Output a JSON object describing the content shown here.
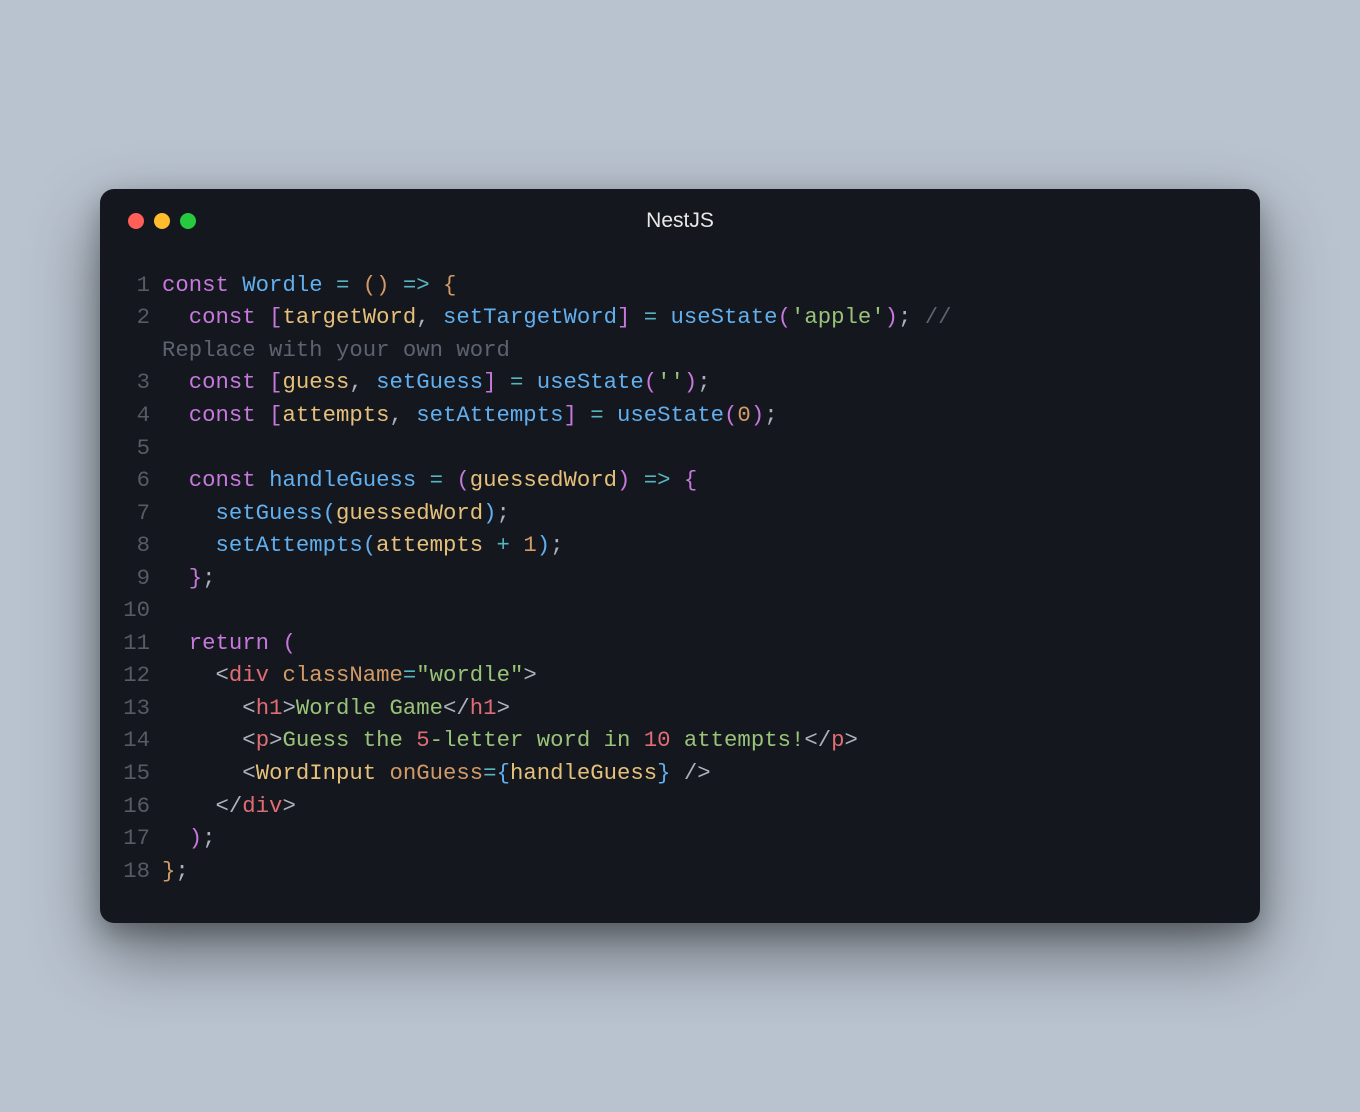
{
  "window": {
    "title": "NestJS",
    "dots": [
      "red",
      "yellow",
      "green"
    ]
  },
  "code": {
    "lines": [
      {
        "n": 1,
        "tokens": [
          {
            "t": "const ",
            "c": "c-keyword"
          },
          {
            "t": "Wordle ",
            "c": "c-fn"
          },
          {
            "t": "= ",
            "c": "c-op"
          },
          {
            "t": "(",
            "c": "c-paren"
          },
          {
            "t": ") ",
            "c": "c-paren"
          },
          {
            "t": "=> ",
            "c": "c-op"
          },
          {
            "t": "{",
            "c": "c-paren"
          }
        ]
      },
      {
        "n": 2,
        "tokens": [
          {
            "t": "  ",
            "c": "c-white"
          },
          {
            "t": "const ",
            "c": "c-keyword"
          },
          {
            "t": "[",
            "c": "c-paren2"
          },
          {
            "t": "targetWord",
            "c": "c-var"
          },
          {
            "t": ", ",
            "c": "c-punct"
          },
          {
            "t": "setTargetWord",
            "c": "c-fn"
          },
          {
            "t": "] ",
            "c": "c-paren2"
          },
          {
            "t": "= ",
            "c": "c-op"
          },
          {
            "t": "useState",
            "c": "c-fn"
          },
          {
            "t": "(",
            "c": "c-paren2"
          },
          {
            "t": "'apple'",
            "c": "c-str"
          },
          {
            "t": ")",
            "c": "c-paren2"
          },
          {
            "t": "; ",
            "c": "c-punct"
          },
          {
            "t": "// ",
            "c": "c-comment"
          }
        ],
        "wrap": [
          {
            "t": "Replace with your own word",
            "c": "c-comment"
          }
        ]
      },
      {
        "n": 3,
        "tokens": [
          {
            "t": "  ",
            "c": "c-white"
          },
          {
            "t": "const ",
            "c": "c-keyword"
          },
          {
            "t": "[",
            "c": "c-paren2"
          },
          {
            "t": "guess",
            "c": "c-var"
          },
          {
            "t": ", ",
            "c": "c-punct"
          },
          {
            "t": "setGuess",
            "c": "c-fn"
          },
          {
            "t": "] ",
            "c": "c-paren2"
          },
          {
            "t": "= ",
            "c": "c-op"
          },
          {
            "t": "useState",
            "c": "c-fn"
          },
          {
            "t": "(",
            "c": "c-paren2"
          },
          {
            "t": "''",
            "c": "c-str"
          },
          {
            "t": ")",
            "c": "c-paren2"
          },
          {
            "t": ";",
            "c": "c-punct"
          }
        ]
      },
      {
        "n": 4,
        "tokens": [
          {
            "t": "  ",
            "c": "c-white"
          },
          {
            "t": "const ",
            "c": "c-keyword"
          },
          {
            "t": "[",
            "c": "c-paren2"
          },
          {
            "t": "attempts",
            "c": "c-var"
          },
          {
            "t": ", ",
            "c": "c-punct"
          },
          {
            "t": "setAttempts",
            "c": "c-fn"
          },
          {
            "t": "] ",
            "c": "c-paren2"
          },
          {
            "t": "= ",
            "c": "c-op"
          },
          {
            "t": "useState",
            "c": "c-fn"
          },
          {
            "t": "(",
            "c": "c-paren2"
          },
          {
            "t": "0",
            "c": "c-num2"
          },
          {
            "t": ")",
            "c": "c-paren2"
          },
          {
            "t": ";",
            "c": "c-punct"
          }
        ]
      },
      {
        "n": 5,
        "tokens": [
          {
            "t": "",
            "c": "c-white"
          }
        ]
      },
      {
        "n": 6,
        "tokens": [
          {
            "t": "  ",
            "c": "c-white"
          },
          {
            "t": "const ",
            "c": "c-keyword"
          },
          {
            "t": "handleGuess ",
            "c": "c-fn"
          },
          {
            "t": "= ",
            "c": "c-op"
          },
          {
            "t": "(",
            "c": "c-paren2"
          },
          {
            "t": "guessedWord",
            "c": "c-var"
          },
          {
            "t": ") ",
            "c": "c-paren2"
          },
          {
            "t": "=> ",
            "c": "c-op"
          },
          {
            "t": "{",
            "c": "c-paren2"
          }
        ]
      },
      {
        "n": 7,
        "tokens": [
          {
            "t": "    ",
            "c": "c-white"
          },
          {
            "t": "setGuess",
            "c": "c-fn"
          },
          {
            "t": "(",
            "c": "c-paren3"
          },
          {
            "t": "guessedWord",
            "c": "c-var"
          },
          {
            "t": ")",
            "c": "c-paren3"
          },
          {
            "t": ";",
            "c": "c-punct"
          }
        ]
      },
      {
        "n": 8,
        "tokens": [
          {
            "t": "    ",
            "c": "c-white"
          },
          {
            "t": "setAttempts",
            "c": "c-fn"
          },
          {
            "t": "(",
            "c": "c-paren3"
          },
          {
            "t": "attempts ",
            "c": "c-var"
          },
          {
            "t": "+ ",
            "c": "c-op"
          },
          {
            "t": "1",
            "c": "c-num2"
          },
          {
            "t": ")",
            "c": "c-paren3"
          },
          {
            "t": ";",
            "c": "c-punct"
          }
        ]
      },
      {
        "n": 9,
        "tokens": [
          {
            "t": "  ",
            "c": "c-white"
          },
          {
            "t": "}",
            "c": "c-paren2"
          },
          {
            "t": ";",
            "c": "c-punct"
          }
        ]
      },
      {
        "n": 10,
        "tokens": [
          {
            "t": "",
            "c": "c-white"
          }
        ]
      },
      {
        "n": 11,
        "tokens": [
          {
            "t": "  ",
            "c": "c-white"
          },
          {
            "t": "return ",
            "c": "c-keyword"
          },
          {
            "t": "(",
            "c": "c-paren2"
          }
        ]
      },
      {
        "n": 12,
        "tokens": [
          {
            "t": "    ",
            "c": "c-white"
          },
          {
            "t": "<",
            "c": "c-tagb"
          },
          {
            "t": "div ",
            "c": "c-tag"
          },
          {
            "t": "className",
            "c": "c-attr"
          },
          {
            "t": "=",
            "c": "c-op"
          },
          {
            "t": "\"wordle\"",
            "c": "c-str"
          },
          {
            "t": ">",
            "c": "c-tagb"
          }
        ]
      },
      {
        "n": 13,
        "tokens": [
          {
            "t": "      ",
            "c": "c-white"
          },
          {
            "t": "<",
            "c": "c-tagb"
          },
          {
            "t": "h1",
            "c": "c-tag"
          },
          {
            "t": ">",
            "c": "c-tagb"
          },
          {
            "t": "Wordle Game",
            "c": "c-str"
          },
          {
            "t": "</",
            "c": "c-tagb"
          },
          {
            "t": "h1",
            "c": "c-tag"
          },
          {
            "t": ">",
            "c": "c-tagb"
          }
        ]
      },
      {
        "n": 14,
        "tokens": [
          {
            "t": "      ",
            "c": "c-white"
          },
          {
            "t": "<",
            "c": "c-tagb"
          },
          {
            "t": "p",
            "c": "c-tag"
          },
          {
            "t": ">",
            "c": "c-tagb"
          },
          {
            "t": "Guess the ",
            "c": "c-str"
          },
          {
            "t": "5",
            "c": "c-num"
          },
          {
            "t": "-letter word in ",
            "c": "c-str"
          },
          {
            "t": "10",
            "c": "c-num"
          },
          {
            "t": " attempts!",
            "c": "c-str"
          },
          {
            "t": "</",
            "c": "c-tagb"
          },
          {
            "t": "p",
            "c": "c-tag"
          },
          {
            "t": ">",
            "c": "c-tagb"
          }
        ]
      },
      {
        "n": 15,
        "tokens": [
          {
            "t": "      ",
            "c": "c-white"
          },
          {
            "t": "<",
            "c": "c-tagb"
          },
          {
            "t": "WordInput ",
            "c": "c-comp"
          },
          {
            "t": "onGuess",
            "c": "c-attr"
          },
          {
            "t": "=",
            "c": "c-op"
          },
          {
            "t": "{",
            "c": "c-paren3"
          },
          {
            "t": "handleGuess",
            "c": "c-var"
          },
          {
            "t": "} ",
            "c": "c-paren3"
          },
          {
            "t": "/>",
            "c": "c-tagb"
          }
        ]
      },
      {
        "n": 16,
        "tokens": [
          {
            "t": "    ",
            "c": "c-white"
          },
          {
            "t": "</",
            "c": "c-tagb"
          },
          {
            "t": "div",
            "c": "c-tag"
          },
          {
            "t": ">",
            "c": "c-tagb"
          }
        ]
      },
      {
        "n": 17,
        "tokens": [
          {
            "t": "  ",
            "c": "c-white"
          },
          {
            "t": ")",
            "c": "c-paren2"
          },
          {
            "t": ";",
            "c": "c-punct"
          }
        ]
      },
      {
        "n": 18,
        "tokens": [
          {
            "t": "}",
            "c": "c-paren"
          },
          {
            "t": ";",
            "c": "c-punct"
          }
        ]
      }
    ]
  }
}
